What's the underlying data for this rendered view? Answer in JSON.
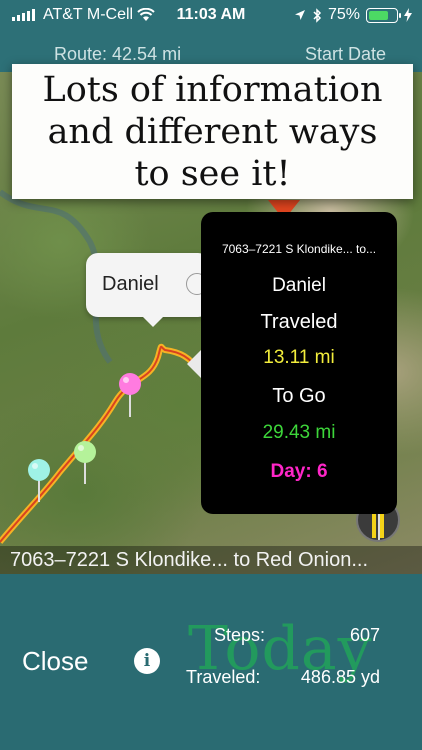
{
  "status_bar": {
    "carrier": "AT&T M-Cell",
    "time": "11:03 AM",
    "battery_percent": "75%",
    "battery_level": 0.75,
    "battery_color": "#4cd964"
  },
  "header": {
    "route": "Route:  42.54 mi",
    "start_date": "Start Date"
  },
  "banner": {
    "text": "Lots of information and different ways to see it!"
  },
  "callout": {
    "name": "Daniel"
  },
  "popup": {
    "address": "7063–7221 S Klondike... to...",
    "name": "Daniel",
    "traveled_label": "Traveled",
    "traveled_value": "13.11 mi",
    "to_go_label": "To Go",
    "to_go_value": "29.43 mi",
    "day": "Day: 6",
    "colors": {
      "traveled": "#f3ee3c",
      "to_go": "#3dd63a",
      "day": "#ff26c8"
    }
  },
  "map": {
    "address_strip": "7063–7221 S Klondike... to Red Onion...",
    "route_color": "#f5b325",
    "pin_colors": [
      "#ff7be0",
      "#b5f29a",
      "#9ff2e6"
    ]
  },
  "bottom": {
    "close_label": "Close",
    "info_icon": "i",
    "watermark": "Today",
    "steps_label": "Steps:",
    "steps_value": "607",
    "traveled_label": "Traveled:",
    "traveled_value": "486.85 yd"
  }
}
